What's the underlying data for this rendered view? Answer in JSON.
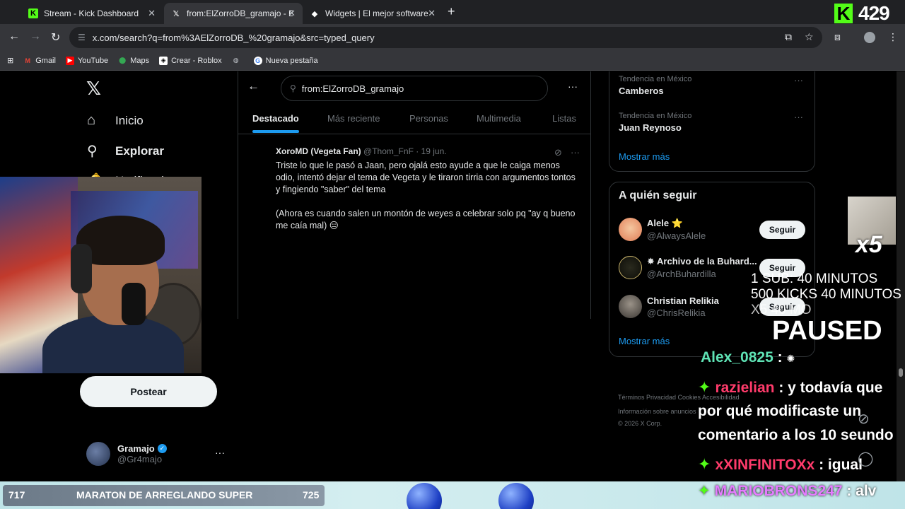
{
  "browser": {
    "tabs": [
      {
        "label": "Stream - Kick Dashboard",
        "icon": "kick-icon",
        "active": false
      },
      {
        "label": "from:ElZorroDB_gramajo - Bus",
        "icon": "x-icon",
        "active": true
      },
      {
        "label": "Widgets | El mejor software par",
        "icon": "widget-icon",
        "active": false
      }
    ],
    "url": "x.com/search?q=from%3AElZorroDB_%20gramajo&src=typed_query",
    "bookmarks": [
      {
        "label": "Gmail",
        "icon": "gmail-icon"
      },
      {
        "label": "YouTube",
        "icon": "youtube-icon"
      },
      {
        "label": "Maps",
        "icon": "maps-icon"
      },
      {
        "label": "Crear - Roblox",
        "icon": "roblox-icon"
      },
      {
        "label": "",
        "icon": "globe-icon"
      },
      {
        "label": "Nueva pestaña",
        "icon": "google-icon"
      }
    ]
  },
  "kick_counter": {
    "value": "429"
  },
  "nav": {
    "items": [
      {
        "label": "Inicio",
        "icon": "home-icon"
      },
      {
        "label": "Explorar",
        "icon": "search-icon"
      },
      {
        "label": "Notificaciones",
        "icon": "bell-icon"
      }
    ],
    "post_label": "Postear",
    "profile": {
      "name": "Gramajo",
      "handle": "@Gr4majo"
    }
  },
  "search": {
    "value": "from:ElZorroDB_gramajo",
    "tabs": [
      "Destacado",
      "Más reciente",
      "Personas",
      "Multimedia",
      "Listas"
    ]
  },
  "tweet": {
    "author": "XoroMD (Vegeta Fan)",
    "handle": "@Thom_FnF",
    "date": "· 19 jun.",
    "para1": "Triste lo que le pasó a Jaan, pero ojalá esto ayude a que le caiga menos odio, intentó dejar el tema de Vegeta y le tiraron tirria con argumentos tontos y fingiendo \"saber\" del tema",
    "para2": "(Ahora es cuando salen un montón de weyes a celebrar solo pq \"ay q bueno me caía mal) 😑"
  },
  "trends": [
    {
      "context": "Tendencia en México",
      "name": "Camberos"
    },
    {
      "context": "Tendencia en México",
      "name": "Juan Reynoso"
    }
  ],
  "show_more": "Mostrar más",
  "who_to_follow": {
    "title": "A quién seguir",
    "button": "Seguir",
    "accounts": [
      {
        "name": "Alele ⭐",
        "handle": "@AlwaysAlele"
      },
      {
        "name": "✸ Archivo de la Buhard...",
        "handle": "@ArchBuhardilla"
      },
      {
        "name": "Christian Relikia",
        "handle": "@ChrisRelikia"
      }
    ]
  },
  "footer": {
    "line1": "Términos    Privacidad    Cookies    Accesibilidad",
    "line2": "Información sobre anuncios",
    "line3": "© 2026 X Corp."
  },
  "overlay": {
    "multiplier": "x5",
    "timer_lines": [
      "1 SUB: 40 MINUTOS",
      "500 KICKS 40 MINUTOS",
      "X5 40 MO"
    ],
    "paused": "PAUSED",
    "chat": [
      {
        "user": "Alex_0825",
        "text": " : ",
        "color": "#5fe3b5",
        "badge": false
      },
      {
        "user": "razielian",
        "text": " : y todavía que",
        "color": "#ff3b6b",
        "badge": true
      },
      {
        "user": "",
        "text": "por qué modificaste un",
        "color": "#ffffff",
        "badge": false
      },
      {
        "user": "",
        "text": "comentario a los 10 seundo",
        "color": "#ffffff",
        "badge": false
      },
      {
        "user": "xXINFINITOXx",
        "text": " : igual",
        "color": "#ff3b6b",
        "badge": true
      }
    ],
    "chat_last": {
      "user": "MARIOBRONS247",
      "text": " : alv",
      "color": "#e57cff"
    }
  },
  "ticker": {
    "left": "717",
    "title": "MARATON DE ARREGLANDO SUPER",
    "right": "725"
  }
}
